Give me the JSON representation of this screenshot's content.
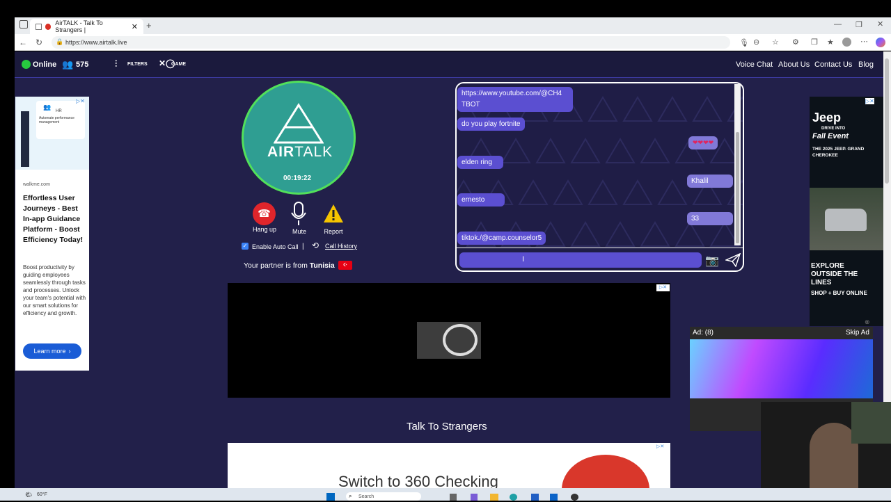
{
  "browser": {
    "tab_title": "AirTALK - Talk To Strangers |",
    "url": "https://www.airtalk.live",
    "new_tab_icon": "+"
  },
  "nav": {
    "status": "Online",
    "user_count": "575",
    "filters": "FILTERS",
    "game": "GAME",
    "links": [
      "Voice Chat",
      "About Us",
      "Contact Us",
      "Blog"
    ]
  },
  "logo": {
    "brand_air": "AIR",
    "brand_talk": "TALK",
    "timer": "00:19:22"
  },
  "controls": {
    "hangup": "Hang up",
    "mute": "Mute",
    "report": "Report",
    "auto_call": "Enable Auto Call",
    "separator": "|",
    "call_history": "Call History",
    "partner_prefix": "Your partner is from ",
    "partner_country": "Tunisia"
  },
  "chat": {
    "messages": [
      {
        "side": "left",
        "text": "https://www.youtube.com/@CH4"
      },
      {
        "side": "left",
        "text": "TBOT"
      },
      {
        "side": "left",
        "text": "do you play fortnite"
      },
      {
        "side": "right",
        "text": "❤❤❤❤"
      },
      {
        "side": "left",
        "text": "elden ring"
      },
      {
        "side": "right",
        "text": "Khalil"
      },
      {
        "side": "left",
        "text": "ernesto"
      },
      {
        "side": "right",
        "text": "33"
      },
      {
        "side": "left",
        "text": "tiktok./@camp.counselor5"
      }
    ]
  },
  "left_ad": {
    "category": "HR",
    "card_text": "Automate performance management",
    "domain": "walkme.com",
    "headline": "Effortless User Journeys - Best In-app Guidance Platform - Boost Efficiency Today!",
    "body": "Boost productivity by guiding employees seamlessly through tasks and processes. Unlock your team's potential with our smart solutions for efficiency and growth.",
    "cta": "Learn more"
  },
  "right_ad": {
    "brand": "Jeep",
    "line1": "DRIVE INTO",
    "line2": "Fall Event",
    "line3": "THE 2025 JEEP. GRAND CHEROKEE",
    "line4": "EXPLORE OUTSIDE THE LINES",
    "line5": "SHOP + BUY ONLINE"
  },
  "video_ad": {
    "label": "Ad: (8)",
    "skip": "Skip Ad"
  },
  "section_title": "Talk To Strangers",
  "bottom_ad": {
    "headline": "Switch to 360 Checking"
  },
  "taskbar": {
    "weather": "60°F",
    "search": "Search"
  },
  "colors": {
    "page_bg": "#22204a",
    "nav_bg": "#1b1a3d",
    "chat_bubble": "#5b4fd1",
    "logo_bg": "#2f9e92",
    "logo_ring": "#52e05a",
    "hangup": "#e0252b",
    "report": "#f5c400"
  }
}
